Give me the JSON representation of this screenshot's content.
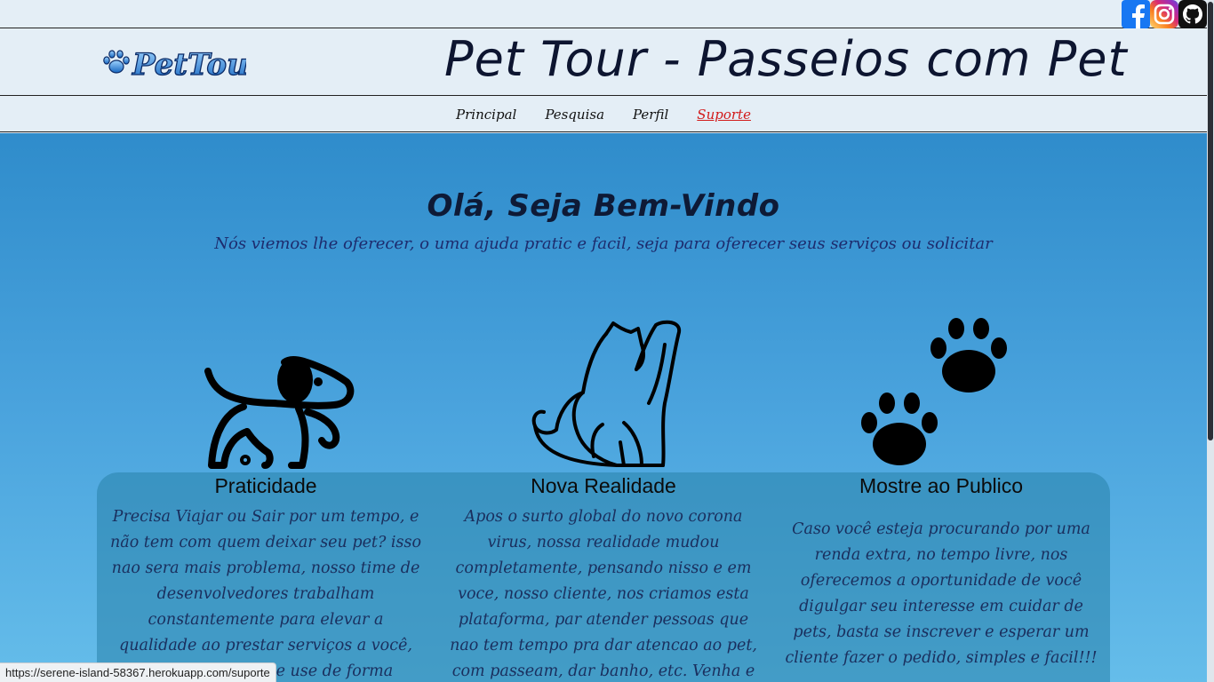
{
  "social": {
    "facebook": "facebook-icon",
    "instagram": "instagram-icon",
    "github": "github-icon"
  },
  "header": {
    "logo_text": "PetTour",
    "title": "Pet Tour - Passeios com Pet"
  },
  "nav": {
    "items": [
      {
        "label": "Principal"
      },
      {
        "label": "Pesquisa"
      },
      {
        "label": "Perfil"
      },
      {
        "label": "Suporte",
        "active": true
      }
    ]
  },
  "hero": {
    "welcome": "Olá, Seja Bem-Vindo",
    "subtitle": "Nós viemos lhe oferecer, o uma ajuda pratic e facil, seja para oferecer seus serviços ou solicitar"
  },
  "cards": [
    {
      "icon": "dog-icon",
      "title": "Praticidade",
      "text": "Precisa Viajar ou Sair por um tempo, e não tem com quem deixar seu pet? isso nao sera mais problema, nosso time de desenvolvedores trabalham constantemente para elevar a qualidade ao prestar serviços a você, nao perca tempo e use de forma inteligente!!!"
    },
    {
      "icon": "cat-icon",
      "title": "Nova Realidade",
      "text": "Apos o surto global do novo corona virus, nossa realidade mudou completamente, pensando nisso e em voce, nosso cliente, nos criamos esta plataforma, par atender pessoas que nao tem tempo pra dar atencao ao pet, com passeam, dar banho, etc. Venha e procure ja por nossos serviços"
    },
    {
      "icon": "paw-prints-icon",
      "title": "Mostre ao Publico",
      "text": "Caso você esteja procurando por uma renda extra, no tempo livre, nos oferecemos a oportunidade de você digulgar seu interesse em cuidar de pets, basta se inscrever e esperar um cliente fazer o pedido, simples e facil!!!"
    }
  ],
  "status_bar": {
    "url": "https://serene-island-58367.herokuapp.com/suporte"
  },
  "colors": {
    "accent_active": "#d21a1a",
    "header_bg": "#e4eef6",
    "gradient_top": "#2f8ccb",
    "gradient_bottom": "#65bdea"
  }
}
